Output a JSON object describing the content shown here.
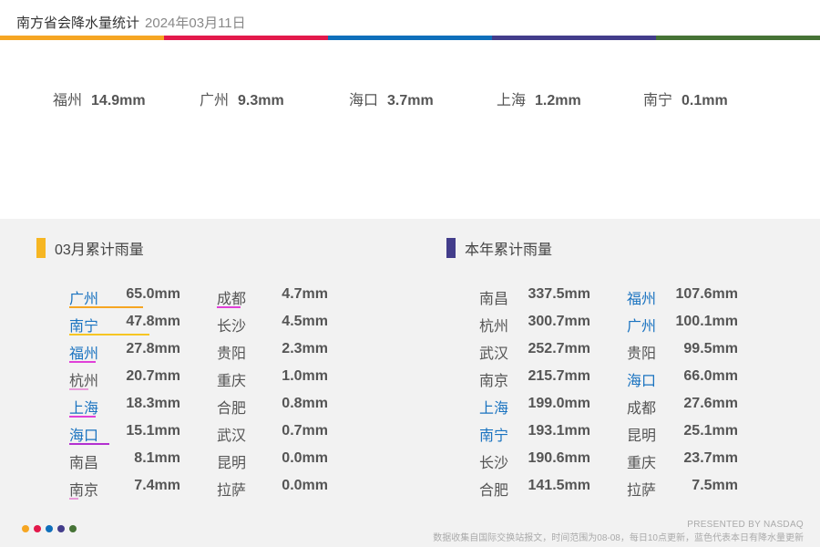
{
  "header": {
    "title": "南方省会降水量统计",
    "date": "2024年03月11日"
  },
  "colors": {
    "orange": "#f6a623",
    "red": "#e3194b",
    "blue": "#0f6fbb",
    "indigo": "#433d8b",
    "green": "#467336",
    "blue_text": "#1a73c0",
    "magenta": "#e040d8",
    "violet": "#8844ee"
  },
  "today": [
    {
      "city": "福州",
      "value": "14.9mm"
    },
    {
      "city": "广州",
      "value": "9.3mm"
    },
    {
      "city": "海口",
      "value": "3.7mm"
    },
    {
      "city": "上海",
      "value": "1.2mm"
    },
    {
      "city": "南宁",
      "value": "0.1mm"
    }
  ],
  "monthly": {
    "title": "03月累计雨量",
    "col1": [
      {
        "city": "广州",
        "value": "65.0mm",
        "blue": true,
        "fraction": 0.62,
        "color": "#f6a623"
      },
      {
        "city": "南宁",
        "value": "47.8mm",
        "blue": true,
        "fraction": 0.68,
        "color": "#f6c623"
      },
      {
        "city": "福州",
        "value": "27.8mm",
        "blue": true,
        "fraction": 0.22,
        "color": "#e040d8"
      },
      {
        "city": "杭州",
        "value": "20.7mm",
        "blue": false,
        "fraction": 0.16,
        "color": "#e89ad8"
      },
      {
        "city": "上海",
        "value": "18.3mm",
        "blue": true,
        "fraction": 0.22,
        "color": "#e040d8"
      },
      {
        "city": "海口",
        "value": "15.1mm",
        "blue": true,
        "fraction": 0.34,
        "color": "#b330d0"
      },
      {
        "city": "南昌",
        "value": "8.1mm",
        "blue": false,
        "fraction": 0,
        "color": ""
      },
      {
        "city": "南京",
        "value": "7.4mm",
        "blue": false,
        "fraction": 0.08,
        "color": "#e89ad8"
      }
    ],
    "col2": [
      {
        "city": "成都",
        "value": "4.7mm",
        "blue": false,
        "fraction": 0.2,
        "color": "#e040d8"
      },
      {
        "city": "长沙",
        "value": "4.5mm",
        "blue": false,
        "fraction": 0,
        "color": ""
      },
      {
        "city": "贵阳",
        "value": "2.3mm",
        "blue": false,
        "fraction": 0,
        "color": ""
      },
      {
        "city": "重庆",
        "value": "1.0mm",
        "blue": false,
        "fraction": 0,
        "color": ""
      },
      {
        "city": "合肥",
        "value": "0.8mm",
        "blue": false,
        "fraction": 0,
        "color": ""
      },
      {
        "city": "武汉",
        "value": "0.7mm",
        "blue": false,
        "fraction": 0,
        "color": ""
      },
      {
        "city": "昆明",
        "value": "0.0mm",
        "blue": false,
        "fraction": 0,
        "color": ""
      },
      {
        "city": "拉萨",
        "value": "0.0mm",
        "blue": false,
        "fraction": 0,
        "color": ""
      }
    ]
  },
  "yearly": {
    "title": "本年累计雨量",
    "col1": [
      {
        "city": "南昌",
        "value": "337.5mm",
        "blue": false
      },
      {
        "city": "杭州",
        "value": "300.7mm",
        "blue": false
      },
      {
        "city": "武汉",
        "value": "252.7mm",
        "blue": false
      },
      {
        "city": "南京",
        "value": "215.7mm",
        "blue": false
      },
      {
        "city": "上海",
        "value": "199.0mm",
        "blue": true
      },
      {
        "city": "南宁",
        "value": "193.1mm",
        "blue": true
      },
      {
        "city": "长沙",
        "value": "190.6mm",
        "blue": false
      },
      {
        "city": "合肥",
        "value": "141.5mm",
        "blue": false
      }
    ],
    "col2": [
      {
        "city": "福州",
        "value": "107.6mm",
        "blue": true
      },
      {
        "city": "广州",
        "value": "100.1mm",
        "blue": true
      },
      {
        "city": "贵阳",
        "value": "99.5mm",
        "blue": false
      },
      {
        "city": "海口",
        "value": "66.0mm",
        "blue": true
      },
      {
        "city": "成都",
        "value": "27.6mm",
        "blue": false
      },
      {
        "city": "昆明",
        "value": "25.1mm",
        "blue": false
      },
      {
        "city": "重庆",
        "value": "23.7mm",
        "blue": false
      },
      {
        "city": "拉萨",
        "value": "7.5mm",
        "blue": false
      }
    ]
  },
  "footer": {
    "brand": "PRESENTED BY NASDAQ",
    "note": "数据收集自国际交换站报文，时间范围为08-08，每日10点更新，蓝色代表本日有降水量更新"
  }
}
